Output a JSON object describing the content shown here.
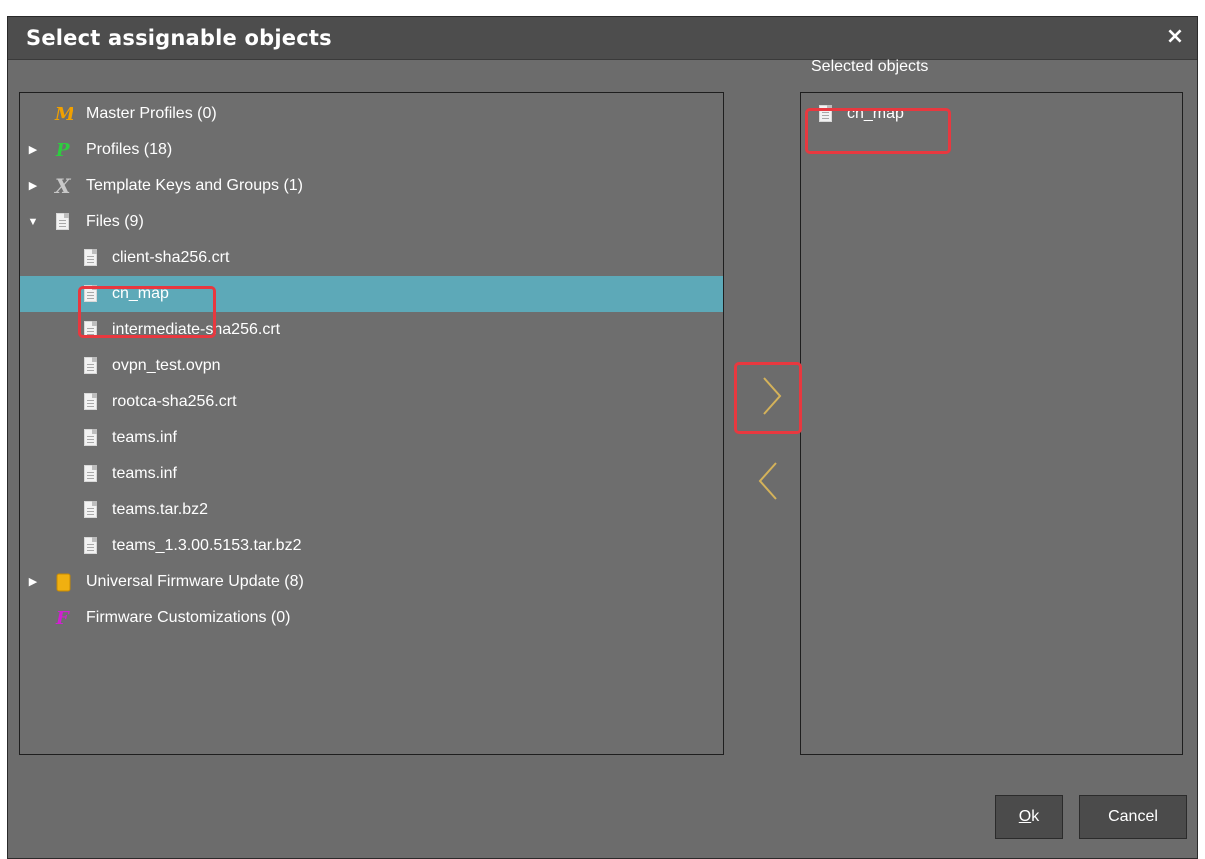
{
  "dialog": {
    "title": "Select assignable objects",
    "close_glyph": "×"
  },
  "tree": {
    "items": [
      {
        "label": "Master Profiles (0)",
        "icon": "master-profiles-icon",
        "expandable": false
      },
      {
        "label": "Profiles (18)",
        "icon": "profiles-icon",
        "expandable": true,
        "expanded": false
      },
      {
        "label": "Template Keys and Groups (1)",
        "icon": "template-keys-icon",
        "expandable": true,
        "expanded": false
      },
      {
        "label": "Files (9)",
        "icon": "file-icon",
        "expandable": true,
        "expanded": true,
        "children": [
          {
            "label": "client-sha256.crt"
          },
          {
            "label": "cn_map",
            "selected": true
          },
          {
            "label": "intermediate-sha256.crt"
          },
          {
            "label": "ovpn_test.ovpn"
          },
          {
            "label": "rootca-sha256.crt"
          },
          {
            "label": "teams.inf"
          },
          {
            "label": "teams.inf"
          },
          {
            "label": "teams.tar.bz2"
          },
          {
            "label": "teams_1.3.00.5153.tar.bz2"
          }
        ]
      },
      {
        "label": "Universal Firmware Update (8)",
        "icon": "firmware-update-icon",
        "expandable": true,
        "expanded": false
      },
      {
        "label": "Firmware Customizations (0)",
        "icon": "firmware-customizations-icon",
        "expandable": false
      }
    ]
  },
  "selected_panel": {
    "header": "Selected objects",
    "items": [
      {
        "label": "cn_map"
      }
    ]
  },
  "buttons": {
    "ok_mnemonic": "O",
    "ok_rest": "k",
    "cancel": "Cancel",
    "add_glyph": "›",
    "remove_glyph": "‹"
  },
  "colors": {
    "dialog_bg": "#6c6c6c",
    "selection": "#5da9b8",
    "highlight": "#e8383f",
    "arrow_accent": "#d4b25a"
  }
}
